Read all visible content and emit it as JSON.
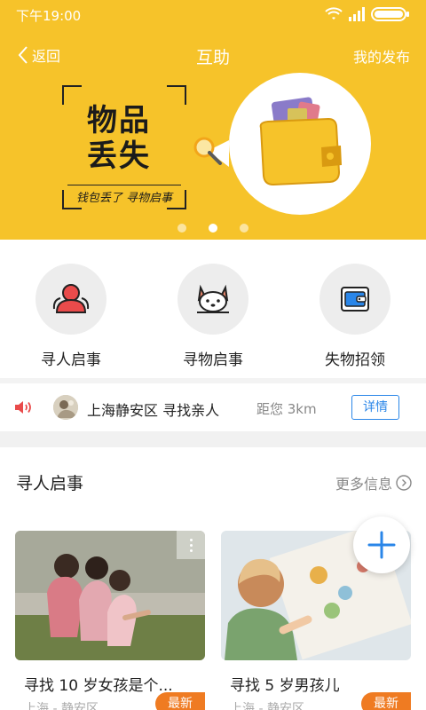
{
  "status_bar": {
    "time": "下午19:00",
    "wifi_icon": "wifi-icon",
    "signal_icon": "signal-icon",
    "battery_icon": "battery-icon"
  },
  "navbar": {
    "back_label": "返回",
    "title": "互助",
    "right_label": "我的发布"
  },
  "banner": {
    "title_line1": "物品",
    "title_line2": "丢失",
    "subtitle": "钱包丢了 寻物启事",
    "illustration": "wallet-magnifier-illustration",
    "page_count": 3,
    "active_page": 2
  },
  "categories": [
    {
      "label": "寻人启事",
      "icon": "person-icon"
    },
    {
      "label": "寻物启事",
      "icon": "dog-icon"
    },
    {
      "label": "失物招领",
      "icon": "wallet-icon"
    }
  ],
  "ticker": {
    "icon": "speaker-icon",
    "message": "上海静安区 寻找亲人",
    "distance": "距您 3km",
    "detail_label": "详情"
  },
  "section": {
    "title": "寻人启事",
    "more_label": "更多信息"
  },
  "cards": [
    {
      "title": "寻找 10 岁女孩是个...",
      "location": "上海 - 静安区",
      "badge": "最新",
      "image": "children-sitting-photo"
    },
    {
      "title": "寻找 5 岁男孩儿",
      "location": "上海 - 静安区",
      "badge": "最新",
      "image": "boy-with-map-photo"
    }
  ],
  "fab": {
    "icon": "plus-icon"
  },
  "colors": {
    "primary_yellow": "#f6c32a",
    "accent_blue": "#2a86e8",
    "badge_orange": "#ef7b22",
    "speaker_red": "#e94b4b"
  }
}
